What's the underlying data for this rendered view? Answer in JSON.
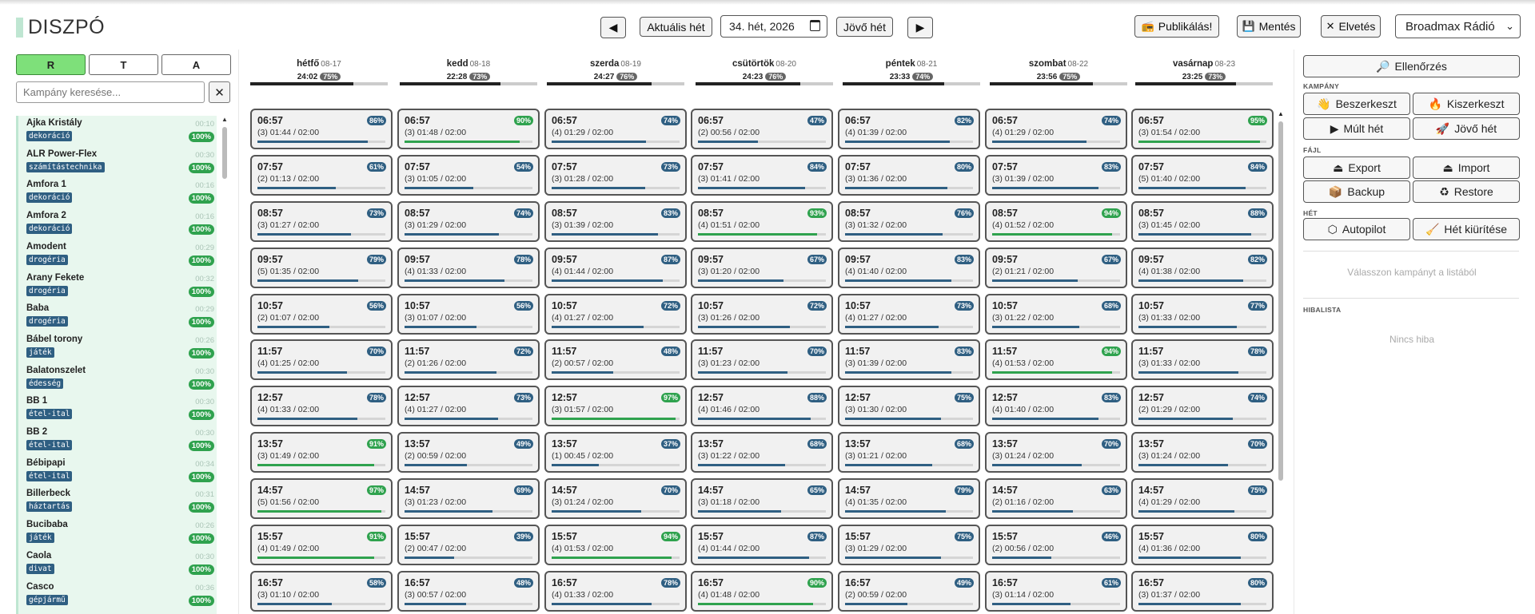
{
  "app": {
    "title": "DISZPÓ"
  },
  "nav": {
    "prev": "◀",
    "current_week": "Aktuális hét",
    "week_value": "34. hét, 2026",
    "next_week": "Jövő hét",
    "next": "▶"
  },
  "actions": {
    "publish": "Publikálás!",
    "save": "Mentés",
    "discard": "Elvetés",
    "station": "Broadmax Rádió"
  },
  "left": {
    "tabs": [
      "R",
      "T",
      "A"
    ],
    "search_placeholder": "Kampány keresése...",
    "clear": "✕",
    "campaigns": [
      {
        "name": "Ajka Kristály",
        "dur": "00:10",
        "tag": "dekoráció",
        "pct": "100%"
      },
      {
        "name": "ALR Power-Flex",
        "dur": "00:30",
        "tag": "számítástechnika",
        "pct": "100%"
      },
      {
        "name": "Amfora 1",
        "dur": "00:16",
        "tag": "dekoráció",
        "pct": "100%"
      },
      {
        "name": "Amfora 2",
        "dur": "00:16",
        "tag": "dekoráció",
        "pct": "100%"
      },
      {
        "name": "Amodent",
        "dur": "00:29",
        "tag": "drogéria",
        "pct": "100%"
      },
      {
        "name": "Arany Fekete",
        "dur": "00:32",
        "tag": "drogéria",
        "pct": "100%"
      },
      {
        "name": "Baba",
        "dur": "00:29",
        "tag": "drogéria",
        "pct": "100%"
      },
      {
        "name": "Bábel torony",
        "dur": "00:26",
        "tag": "játék",
        "pct": "100%"
      },
      {
        "name": "Balatonszelet",
        "dur": "00:30",
        "tag": "édesség",
        "pct": "100%"
      },
      {
        "name": "BB 1",
        "dur": "00:30",
        "tag": "étel-ital",
        "pct": "100%"
      },
      {
        "name": "BB 2",
        "dur": "00:30",
        "tag": "étel-ital",
        "pct": "100%"
      },
      {
        "name": "Bébipapi",
        "dur": "00:34",
        "tag": "étel-ital",
        "pct": "100%"
      },
      {
        "name": "Billerbeck",
        "dur": "00:31",
        "tag": "háztartás",
        "pct": "100%"
      },
      {
        "name": "Bucibaba",
        "dur": "00:26",
        "tag": "játék",
        "pct": "100%"
      },
      {
        "name": "Caola",
        "dur": "00:30",
        "tag": "divat",
        "pct": "100%"
      },
      {
        "name": "Casco",
        "dur": "00:36",
        "tag": "gépjármű",
        "pct": "100%"
      }
    ]
  },
  "days": [
    {
      "name": "hétfő",
      "date": "08-17",
      "total": "24:02",
      "pct": "75%",
      "fill": 0.75
    },
    {
      "name": "kedd",
      "date": "08-18",
      "total": "22:28",
      "pct": "73%",
      "fill": 0.73
    },
    {
      "name": "szerda",
      "date": "08-19",
      "total": "24:27",
      "pct": "76%",
      "fill": 0.76
    },
    {
      "name": "csütörtök",
      "date": "08-20",
      "total": "24:23",
      "pct": "76%",
      "fill": 0.76
    },
    {
      "name": "péntek",
      "date": "08-21",
      "total": "23:33",
      "pct": "74%",
      "fill": 0.74
    },
    {
      "name": "szombat",
      "date": "08-22",
      "total": "23:56",
      "pct": "75%",
      "fill": 0.75
    },
    {
      "name": "vasárnap",
      "date": "08-23",
      "total": "23:25",
      "pct": "73%",
      "fill": 0.73
    }
  ],
  "grid": [
    [
      {
        "time": "06:57",
        "sub": "(3) 01:44 / 02:00",
        "pct": 86
      },
      {
        "time": "07:57",
        "sub": "(2) 01:13 / 02:00",
        "pct": 61
      },
      {
        "time": "08:57",
        "sub": "(3) 01:27 / 02:00",
        "pct": 73
      },
      {
        "time": "09:57",
        "sub": "(5) 01:35 / 02:00",
        "pct": 79
      },
      {
        "time": "10:57",
        "sub": "(2) 01:07 / 02:00",
        "pct": 56
      },
      {
        "time": "11:57",
        "sub": "(4) 01:25 / 02:00",
        "pct": 70
      },
      {
        "time": "12:57",
        "sub": "(4) 01:33 / 02:00",
        "pct": 78
      },
      {
        "time": "13:57",
        "sub": "(3) 01:49 / 02:00",
        "pct": 91
      },
      {
        "time": "14:57",
        "sub": "(5) 01:56 / 02:00",
        "pct": 97
      },
      {
        "time": "15:57",
        "sub": "(4) 01:49 / 02:00",
        "pct": 91
      },
      {
        "time": "16:57",
        "sub": "(3) 01:10 / 02:00",
        "pct": 58
      }
    ],
    [
      {
        "time": "06:57",
        "sub": "(3) 01:48 / 02:00",
        "pct": 90
      },
      {
        "time": "07:57",
        "sub": "(3) 01:05 / 02:00",
        "pct": 54
      },
      {
        "time": "08:57",
        "sub": "(3) 01:29 / 02:00",
        "pct": 74
      },
      {
        "time": "09:57",
        "sub": "(4) 01:33 / 02:00",
        "pct": 78
      },
      {
        "time": "10:57",
        "sub": "(3) 01:07 / 02:00",
        "pct": 56
      },
      {
        "time": "11:57",
        "sub": "(2) 01:26 / 02:00",
        "pct": 72
      },
      {
        "time": "12:57",
        "sub": "(4) 01:27 / 02:00",
        "pct": 73
      },
      {
        "time": "13:57",
        "sub": "(2) 00:59 / 02:00",
        "pct": 49
      },
      {
        "time": "14:57",
        "sub": "(3) 01:23 / 02:00",
        "pct": 69
      },
      {
        "time": "15:57",
        "sub": "(2) 00:47 / 02:00",
        "pct": 39
      },
      {
        "time": "16:57",
        "sub": "(3) 00:57 / 02:00",
        "pct": 48
      }
    ],
    [
      {
        "time": "06:57",
        "sub": "(4) 01:29 / 02:00",
        "pct": 74
      },
      {
        "time": "07:57",
        "sub": "(3) 01:28 / 02:00",
        "pct": 73
      },
      {
        "time": "08:57",
        "sub": "(3) 01:39 / 02:00",
        "pct": 83
      },
      {
        "time": "09:57",
        "sub": "(4) 01:44 / 02:00",
        "pct": 87
      },
      {
        "time": "10:57",
        "sub": "(4) 01:27 / 02:00",
        "pct": 72
      },
      {
        "time": "11:57",
        "sub": "(2) 00:57 / 02:00",
        "pct": 48
      },
      {
        "time": "12:57",
        "sub": "(3) 01:57 / 02:00",
        "pct": 97
      },
      {
        "time": "13:57",
        "sub": "(1) 00:45 / 02:00",
        "pct": 37
      },
      {
        "time": "14:57",
        "sub": "(3) 01:24 / 02:00",
        "pct": 70
      },
      {
        "time": "15:57",
        "sub": "(4) 01:53 / 02:00",
        "pct": 94
      },
      {
        "time": "16:57",
        "sub": "(4) 01:33 / 02:00",
        "pct": 78
      }
    ],
    [
      {
        "time": "06:57",
        "sub": "(2) 00:56 / 02:00",
        "pct": 47
      },
      {
        "time": "07:57",
        "sub": "(3) 01:41 / 02:00",
        "pct": 84
      },
      {
        "time": "08:57",
        "sub": "(4) 01:51 / 02:00",
        "pct": 93
      },
      {
        "time": "09:57",
        "sub": "(3) 01:20 / 02:00",
        "pct": 67
      },
      {
        "time": "10:57",
        "sub": "(3) 01:26 / 02:00",
        "pct": 72
      },
      {
        "time": "11:57",
        "sub": "(3) 01:23 / 02:00",
        "pct": 70
      },
      {
        "time": "12:57",
        "sub": "(4) 01:46 / 02:00",
        "pct": 88
      },
      {
        "time": "13:57",
        "sub": "(3) 01:22 / 02:00",
        "pct": 68
      },
      {
        "time": "14:57",
        "sub": "(3) 01:18 / 02:00",
        "pct": 65
      },
      {
        "time": "15:57",
        "sub": "(4) 01:44 / 02:00",
        "pct": 87
      },
      {
        "time": "16:57",
        "sub": "(4) 01:48 / 02:00",
        "pct": 90
      }
    ],
    [
      {
        "time": "06:57",
        "sub": "(4) 01:39 / 02:00",
        "pct": 82
      },
      {
        "time": "07:57",
        "sub": "(3) 01:36 / 02:00",
        "pct": 80
      },
      {
        "time": "08:57",
        "sub": "(3) 01:32 / 02:00",
        "pct": 76
      },
      {
        "time": "09:57",
        "sub": "(4) 01:40 / 02:00",
        "pct": 83
      },
      {
        "time": "10:57",
        "sub": "(4) 01:27 / 02:00",
        "pct": 73
      },
      {
        "time": "11:57",
        "sub": "(3) 01:39 / 02:00",
        "pct": 83
      },
      {
        "time": "12:57",
        "sub": "(3) 01:30 / 02:00",
        "pct": 75
      },
      {
        "time": "13:57",
        "sub": "(3) 01:21 / 02:00",
        "pct": 68
      },
      {
        "time": "14:57",
        "sub": "(4) 01:35 / 02:00",
        "pct": 79
      },
      {
        "time": "15:57",
        "sub": "(3) 01:29 / 02:00",
        "pct": 75
      },
      {
        "time": "16:57",
        "sub": "(2) 00:59 / 02:00",
        "pct": 49
      }
    ],
    [
      {
        "time": "06:57",
        "sub": "(4) 01:29 / 02:00",
        "pct": 74
      },
      {
        "time": "07:57",
        "sub": "(3) 01:39 / 02:00",
        "pct": 83
      },
      {
        "time": "08:57",
        "sub": "(4) 01:52 / 02:00",
        "pct": 94
      },
      {
        "time": "09:57",
        "sub": "(2) 01:21 / 02:00",
        "pct": 67
      },
      {
        "time": "10:57",
        "sub": "(3) 01:22 / 02:00",
        "pct": 68
      },
      {
        "time": "11:57",
        "sub": "(4) 01:53 / 02:00",
        "pct": 94
      },
      {
        "time": "12:57",
        "sub": "(4) 01:40 / 02:00",
        "pct": 83
      },
      {
        "time": "13:57",
        "sub": "(3) 01:24 / 02:00",
        "pct": 70
      },
      {
        "time": "14:57",
        "sub": "(2) 01:16 / 02:00",
        "pct": 63
      },
      {
        "time": "15:57",
        "sub": "(2) 00:56 / 02:00",
        "pct": 46
      },
      {
        "time": "16:57",
        "sub": "(3) 01:14 / 02:00",
        "pct": 61
      }
    ],
    [
      {
        "time": "06:57",
        "sub": "(3) 01:54 / 02:00",
        "pct": 95
      },
      {
        "time": "07:57",
        "sub": "(5) 01:40 / 02:00",
        "pct": 84
      },
      {
        "time": "08:57",
        "sub": "(3) 01:45 / 02:00",
        "pct": 88
      },
      {
        "time": "09:57",
        "sub": "(4) 01:38 / 02:00",
        "pct": 82
      },
      {
        "time": "10:57",
        "sub": "(3) 01:33 / 02:00",
        "pct": 77
      },
      {
        "time": "11:57",
        "sub": "(3) 01:33 / 02:00",
        "pct": 78
      },
      {
        "time": "12:57",
        "sub": "(2) 01:29 / 02:00",
        "pct": 74
      },
      {
        "time": "13:57",
        "sub": "(3) 01:24 / 02:00",
        "pct": 70
      },
      {
        "time": "14:57",
        "sub": "(4) 01:29 / 02:00",
        "pct": 75
      },
      {
        "time": "15:57",
        "sub": "(4) 01:36 / 02:00",
        "pct": 80
      },
      {
        "time": "16:57",
        "sub": "(3) 01:37 / 02:00",
        "pct": 80
      }
    ]
  ],
  "right": {
    "check": "Ellenőrzés",
    "sec_campaign": "KAMPÁNY",
    "edit_in": "Beszerkeszt",
    "edit_out": "Kiszerkeszt",
    "last_week": "Múlt hét",
    "next_week": "Jövő hét",
    "sec_file": "FÁJL",
    "export": "Export",
    "import": "Import",
    "backup": "Backup",
    "restore": "Restore",
    "sec_week": "HÉT",
    "autopilot": "Autopilot",
    "clear_week": "Hét kiürítése",
    "select_hint": "Válasszon kampányt a listából",
    "sec_errors": "HIBALISTA",
    "no_errors": "Nincs hiba"
  },
  "colors": {
    "accent_blue": "#2f5f82",
    "accent_green": "#2fa24e",
    "list_bg": "#e8f7ee",
    "active_tab": "#7ee07a"
  }
}
